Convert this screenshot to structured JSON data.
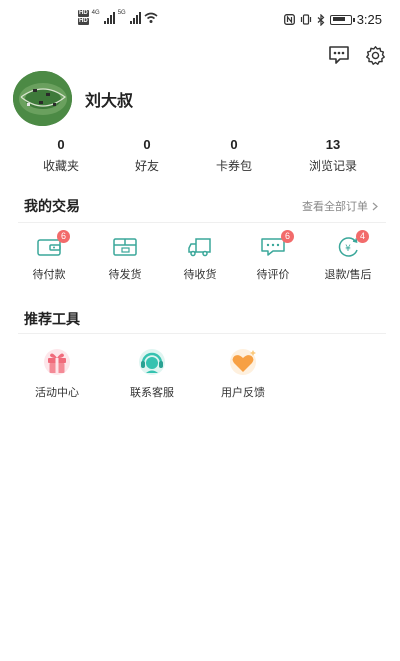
{
  "status_bar": {
    "hd_label_1": "HD",
    "hd_label_2": "HD",
    "net_1": "4G",
    "net_2": "5G",
    "time": "3:25"
  },
  "header_icons": [
    "message-icon",
    "settings-gear-icon"
  ],
  "profile": {
    "username": "刘大叔"
  },
  "stats": [
    {
      "count": "0",
      "label": "收藏夹"
    },
    {
      "count": "0",
      "label": "好友"
    },
    {
      "count": "0",
      "label": "卡券包"
    },
    {
      "count": "13",
      "label": "浏览记录"
    }
  ],
  "transactions": {
    "title": "我的交易",
    "view_all": "查看全部订单",
    "items": [
      {
        "label": "待付款",
        "icon": "wallet-icon",
        "badge": "6"
      },
      {
        "label": "待发货",
        "icon": "package-icon",
        "badge": ""
      },
      {
        "label": "待收货",
        "icon": "truck-icon",
        "badge": ""
      },
      {
        "label": "待评价",
        "icon": "comment-icon",
        "badge": "6"
      },
      {
        "label": "退款/售后",
        "icon": "refund-icon",
        "badge": "4"
      }
    ]
  },
  "tools": {
    "title": "推荐工具",
    "items": [
      {
        "label": "活动中心",
        "icon": "gift-icon"
      },
      {
        "label": "联系客服",
        "icon": "customer-service-icon"
      },
      {
        "label": "用户反馈",
        "icon": "heart-feedback-icon"
      }
    ]
  },
  "colors": {
    "accent_teal": "#3aa79a",
    "badge_red": "#f26b6b",
    "gift_pink": "#f06b7b",
    "service_teal": "#35c2b0",
    "heart_orange": "#f7a043"
  }
}
